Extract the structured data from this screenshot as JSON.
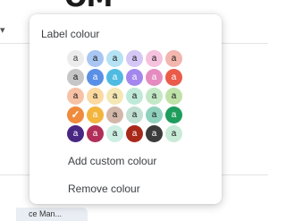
{
  "background": {
    "logo_text": "OM",
    "tab_label": "ce Man..."
  },
  "popup": {
    "title": "Label colour",
    "add_custom_label": "Add custom colour",
    "remove_label": "Remove colour",
    "swatch_glyph": "a",
    "selected_glyph": "✓",
    "selected": {
      "row": 3,
      "col": 0
    },
    "rows": [
      [
        {
          "bg": "#ececec",
          "fg": "#3c3c3c"
        },
        {
          "bg": "#a9c6f3",
          "fg": "#1a1a1a"
        },
        {
          "bg": "#b4e2f4",
          "fg": "#1a1a1a"
        },
        {
          "bg": "#d4c7f5",
          "fg": "#1a1a1a"
        },
        {
          "bg": "#f4c2dd",
          "fg": "#1a1a1a"
        },
        {
          "bg": "#f2b6ae",
          "fg": "#1a1a1a"
        }
      ],
      [
        {
          "bg": "#c6c6c6",
          "fg": "#1a1a1a"
        },
        {
          "bg": "#5a8fe6",
          "fg": "#ffffff"
        },
        {
          "bg": "#4fbbe2",
          "fg": "#ffffff"
        },
        {
          "bg": "#a487ee",
          "fg": "#ffffff"
        },
        {
          "bg": "#e58bbf",
          "fg": "#ffffff"
        },
        {
          "bg": "#ea5b4a",
          "fg": "#ffffff"
        }
      ],
      [
        {
          "bg": "#f7c1a6",
          "fg": "#1a1a1a"
        },
        {
          "bg": "#fbd9a0",
          "fg": "#1a1a1a"
        },
        {
          "bg": "#f5e7b4",
          "fg": "#1a1a1a"
        },
        {
          "bg": "#bfe9d8",
          "fg": "#1a1a1a"
        },
        {
          "bg": "#c2e8c6",
          "fg": "#1a1a1a"
        },
        {
          "bg": "#bfe2a8",
          "fg": "#1a1a1a"
        }
      ],
      [
        {
          "bg": "#f08a3c",
          "fg": "#ffffff"
        },
        {
          "bg": "#f3b53e",
          "fg": "#ffffff"
        },
        {
          "bg": "#d4b7a9",
          "fg": "#1a1a1a"
        },
        {
          "bg": "#bfe0d2",
          "fg": "#1a1a1a"
        },
        {
          "bg": "#8fd1bd",
          "fg": "#1a1a1a"
        },
        {
          "bg": "#1e9d5c",
          "fg": "#ffffff"
        }
      ],
      [
        {
          "bg": "#4a2683",
          "fg": "#ffffff"
        },
        {
          "bg": "#b02e58",
          "fg": "#ffffff"
        },
        {
          "bg": "#cdeee2",
          "fg": "#1a1a1a"
        },
        {
          "bg": "#a8281a",
          "fg": "#ffffff"
        },
        {
          "bg": "#3b3b3b",
          "fg": "#ffffff"
        },
        {
          "bg": "#c7ebd6",
          "fg": "#1a1a1a"
        }
      ]
    ]
  }
}
